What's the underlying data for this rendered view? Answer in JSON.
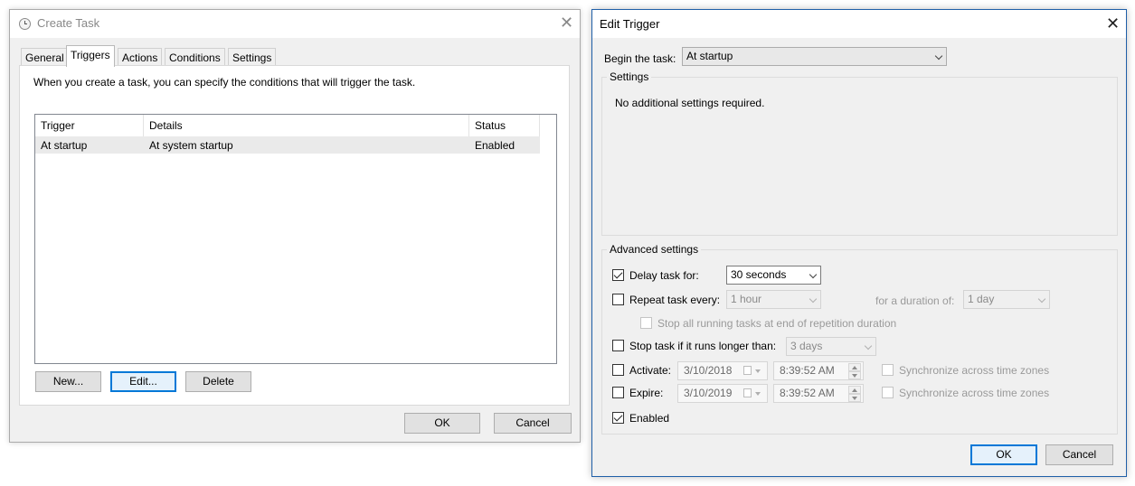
{
  "create_task": {
    "title": "Create Task",
    "tabs": [
      "General",
      "Triggers",
      "Actions",
      "Conditions",
      "Settings"
    ],
    "active_tab": "Triggers",
    "description": "When you create a task, you can specify the conditions that will trigger the task.",
    "table": {
      "columns": [
        "Trigger",
        "Details",
        "Status"
      ],
      "rows": [
        [
          "At startup",
          "At system startup",
          "Enabled"
        ]
      ]
    },
    "buttons": {
      "new": "New...",
      "edit": "Edit...",
      "delete": "Delete"
    },
    "ok": "OK",
    "cancel": "Cancel"
  },
  "edit_trigger": {
    "title": "Edit Trigger",
    "begin_label": "Begin the task:",
    "begin_value": "At startup",
    "settings_label": "Settings",
    "settings_message": "No additional settings required.",
    "advanced_label": "Advanced settings",
    "delay": {
      "label": "Delay task for:",
      "checked": true,
      "value": "30 seconds"
    },
    "repeat": {
      "label": "Repeat task every:",
      "checked": false,
      "value": "1 hour",
      "duration_label": "for a duration of:",
      "duration_value": "1 day"
    },
    "stop_all": {
      "label": "Stop all running tasks at end of repetition duration",
      "checked": false
    },
    "stop_if": {
      "label": "Stop task if it runs longer than:",
      "checked": false,
      "value": "3 days"
    },
    "activate": {
      "label": "Activate:",
      "checked": false,
      "date": "3/10/2018",
      "time": "8:39:52 AM",
      "sync_label": "Synchronize across time zones"
    },
    "expire": {
      "label": "Expire:",
      "checked": false,
      "date": "3/10/2019",
      "time": "8:39:52 AM",
      "sync_label": "Synchronize across time zones"
    },
    "enabled": {
      "label": "Enabled",
      "checked": true
    },
    "ok": "OK",
    "cancel": "Cancel"
  }
}
